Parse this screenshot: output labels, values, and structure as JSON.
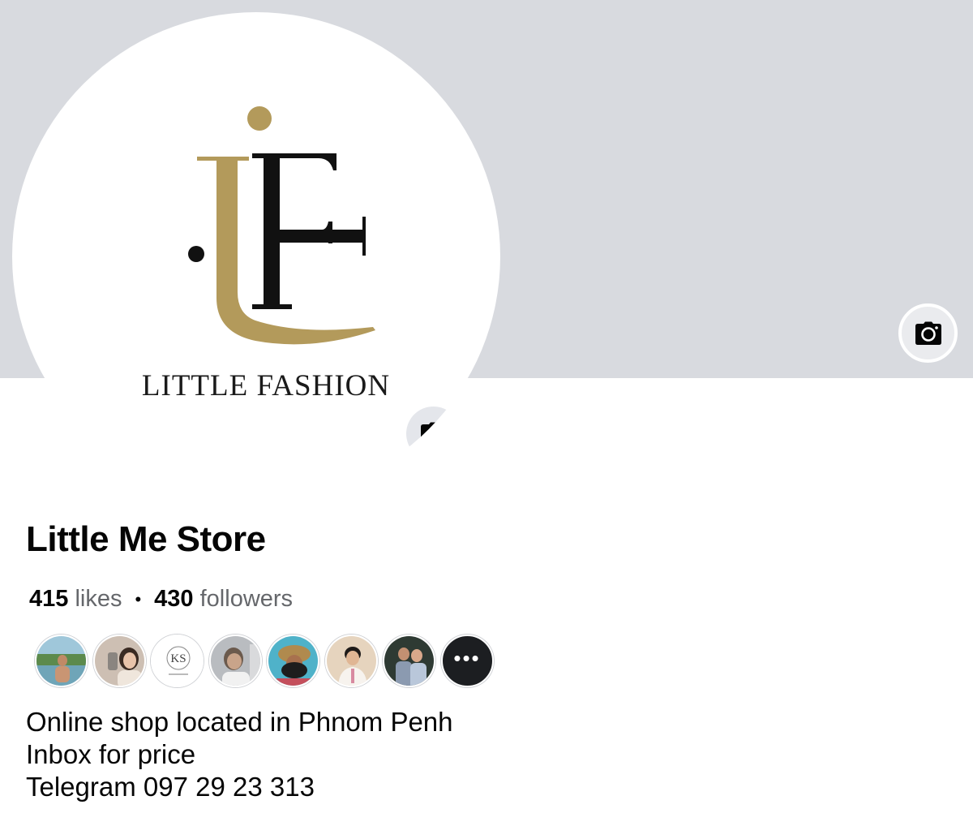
{
  "page": {
    "name": "Little Me Store",
    "likes_count": "415",
    "likes_label": "likes",
    "followers_count": "430",
    "followers_label": "followers",
    "separator": "•"
  },
  "logo": {
    "brand_text": "LITTLE FASHION",
    "monogram": "LF",
    "gold_color": "#b39a5b"
  },
  "icons": {
    "cover_camera": "camera-icon",
    "profile_camera": "camera-icon",
    "more": "more-icon"
  },
  "friends": [
    {
      "name": "friend-avatar-1"
    },
    {
      "name": "friend-avatar-2"
    },
    {
      "name": "friend-avatar-3",
      "logo_text": "KS"
    },
    {
      "name": "friend-avatar-4"
    },
    {
      "name": "friend-avatar-5"
    },
    {
      "name": "friend-avatar-6"
    },
    {
      "name": "friend-avatar-7"
    }
  ],
  "friends_more_label": "•••",
  "bio": {
    "line1": "Online shop located in Phnom Penh",
    "line2": "Inbox for price",
    "line3": "Telegram 097 29 23 313"
  },
  "colors": {
    "cover_bg": "#d8dadf",
    "text_primary": "#050505",
    "text_secondary": "#65676b"
  }
}
